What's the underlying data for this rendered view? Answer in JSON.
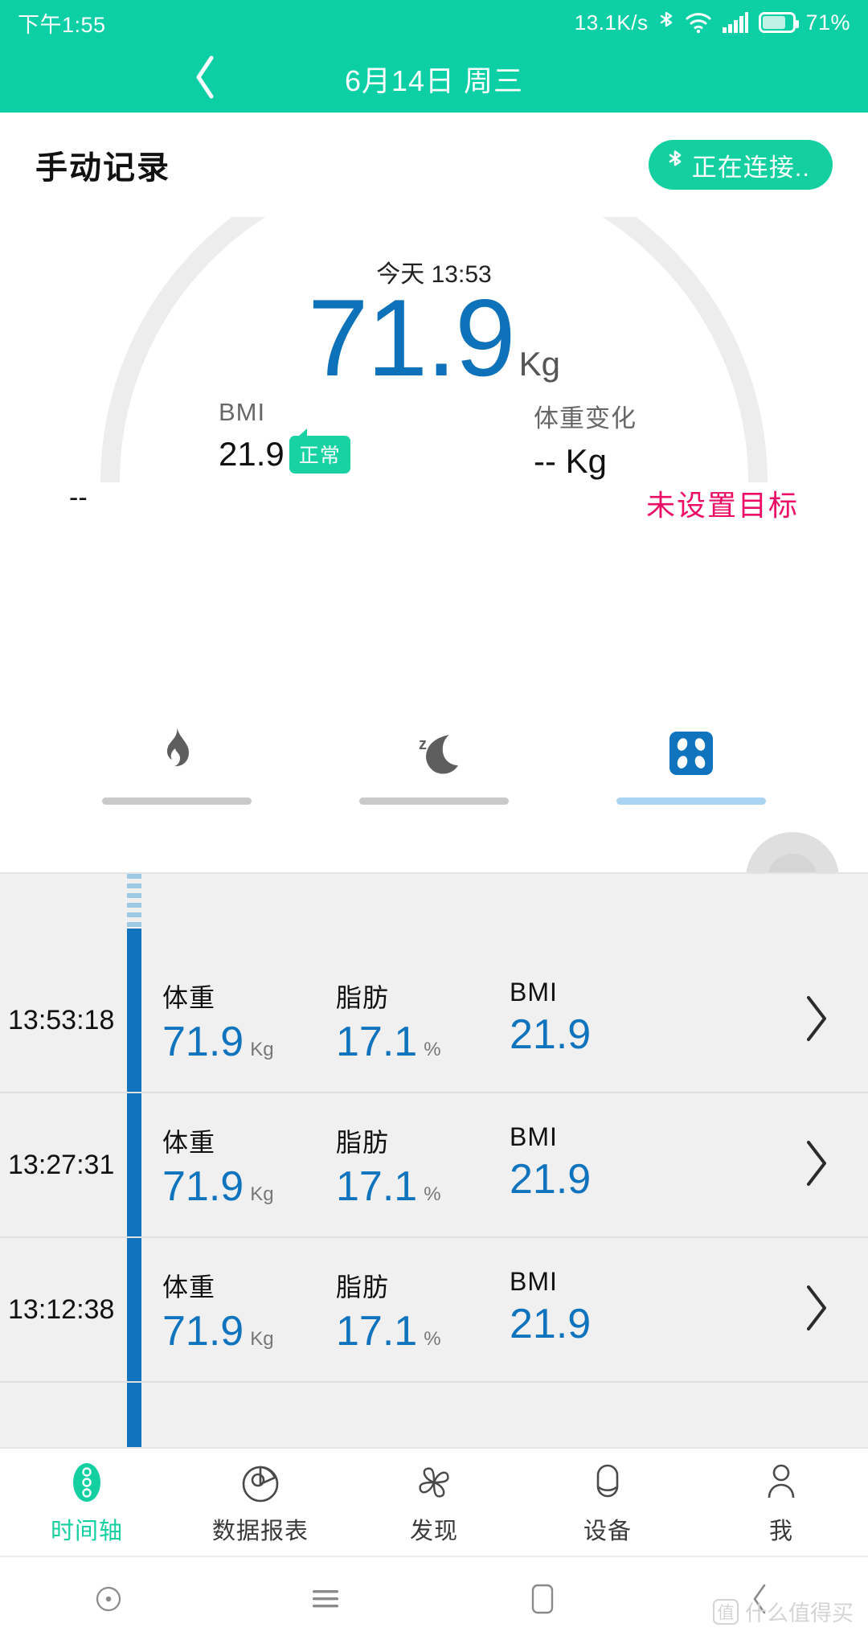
{
  "status_bar": {
    "time": "下午1:55",
    "net_speed": "13.1K/s",
    "battery_percent": "71%",
    "icons": [
      "bluetooth-icon",
      "wifi-icon",
      "signal-icon",
      "battery-icon"
    ]
  },
  "app_bar": {
    "back_icon": "chevron-left-icon",
    "title": "6月14日 周三"
  },
  "section_header": {
    "title": "手动记录",
    "connect_button": {
      "icon": "bluetooth-icon",
      "label": "正在连接.."
    }
  },
  "gauge": {
    "date_label": "今天 13:53",
    "weight_value": "71.9",
    "weight_unit": "Kg",
    "metrics": [
      {
        "label": "BMI",
        "value": "21.9",
        "badge": "正常"
      },
      {
        "label": "体重变化",
        "value": "-- Kg",
        "badge": ""
      }
    ],
    "footer_left": "--",
    "footer_right": "未设置目标",
    "arc_color": "#ededed",
    "value_color": "#0d72b9",
    "badge_color": "#18d2a4",
    "goal_color": "#ec0d66"
  },
  "icon_tabs": [
    {
      "name": "flame-icon",
      "active": false
    },
    {
      "name": "moon-sleep-icon",
      "active": false
    },
    {
      "name": "scale-icon",
      "active": true
    }
  ],
  "timeline": {
    "columns": [
      "体重",
      "脂肪",
      "BMI"
    ],
    "rows": [
      {
        "time": "13:53:18",
        "cells": [
          {
            "label": "体重",
            "value": "71.9",
            "unit": "Kg"
          },
          {
            "label": "脂肪",
            "value": "17.1",
            "unit": "%"
          },
          {
            "label": "BMI",
            "value": "21.9",
            "unit": ""
          }
        ]
      },
      {
        "time": "13:27:31",
        "cells": [
          {
            "label": "体重",
            "value": "71.9",
            "unit": "Kg"
          },
          {
            "label": "脂肪",
            "value": "17.1",
            "unit": "%"
          },
          {
            "label": "BMI",
            "value": "21.9",
            "unit": ""
          }
        ]
      },
      {
        "time": "13:12:38",
        "cells": [
          {
            "label": "体重",
            "value": "71.9",
            "unit": "Kg"
          },
          {
            "label": "脂肪",
            "value": "17.1",
            "unit": "%"
          },
          {
            "label": "BMI",
            "value": "21.9",
            "unit": ""
          }
        ]
      }
    ]
  },
  "bottom_nav": [
    {
      "label": "时间轴",
      "icon": "timeline-icon",
      "active": true
    },
    {
      "label": "数据报表",
      "icon": "pie-chart-icon",
      "active": false
    },
    {
      "label": "发现",
      "icon": "pinwheel-icon",
      "active": false
    },
    {
      "label": "设备",
      "icon": "band-device-icon",
      "active": false
    },
    {
      "label": "我",
      "icon": "person-icon",
      "active": false
    }
  ],
  "system_bar": {
    "buttons": [
      "recent-circle-icon",
      "menu-icon",
      "home-square-icon",
      "back-chevron-icon"
    ],
    "watermark": "什么值得买",
    "watermark_badge": "值"
  },
  "colors": {
    "brand_teal": "#0ccfa6",
    "accent_blue": "#0f74bd",
    "list_bg": "#f0f0f0"
  }
}
